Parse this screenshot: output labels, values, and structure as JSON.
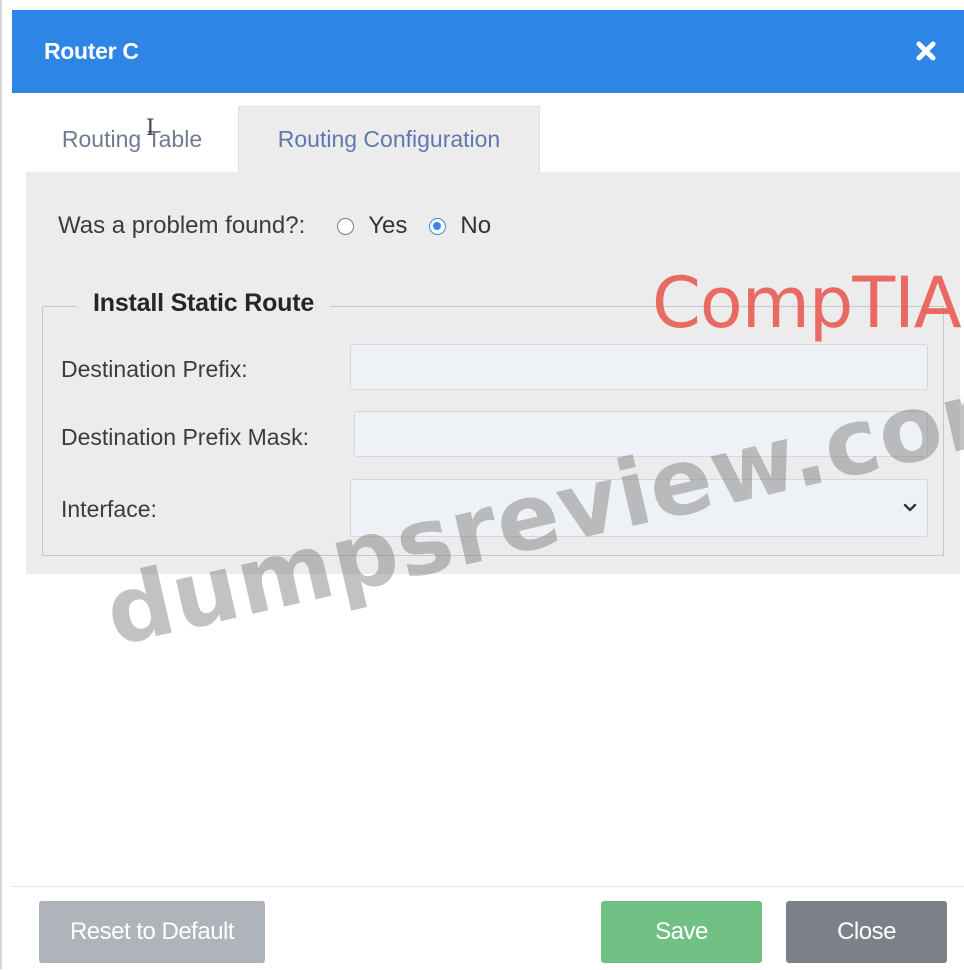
{
  "dialog": {
    "title": "Router C",
    "close_icon": "close-icon"
  },
  "tabs": [
    {
      "label": "Routing Table",
      "active": false
    },
    {
      "label": "Routing Configuration",
      "active": true
    }
  ],
  "question": {
    "label": "Was a problem found?:",
    "options": [
      {
        "label": "Yes",
        "checked": false
      },
      {
        "label": "No",
        "checked": true
      }
    ]
  },
  "static_route": {
    "legend": "Install Static Route",
    "destination_prefix_label": "Destination Prefix:",
    "destination_prefix_value": "",
    "destination_prefix_mask_label": "Destination Prefix Mask:",
    "destination_prefix_mask_value": "",
    "interface_label": "Interface:",
    "interface_value": ""
  },
  "footer": {
    "reset_label": "Reset to Default",
    "save_label": "Save",
    "close_label": "Close"
  },
  "watermarks": {
    "brand": "CompTIA",
    "site": "dumpsreview.com"
  },
  "colors": {
    "titlebar": "#2d86e6",
    "save": "#72c184",
    "close": "#7b8089",
    "reset": "#aeb4b9",
    "brand": "#e85c55"
  }
}
